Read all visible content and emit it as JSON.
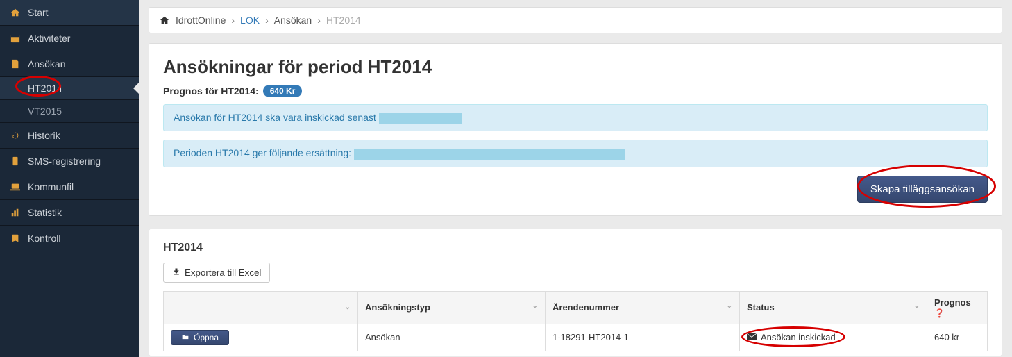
{
  "sidebar": {
    "items": [
      {
        "label": "Start"
      },
      {
        "label": "Aktiviteter"
      },
      {
        "label": "Ansökan"
      },
      {
        "label": "Historik"
      },
      {
        "label": "SMS-registrering"
      },
      {
        "label": "Kommunfil"
      },
      {
        "label": "Statistik"
      },
      {
        "label": "Kontroll"
      }
    ],
    "sub_items": [
      {
        "label": "HT2014",
        "active": true
      },
      {
        "label": "VT2015",
        "active": false
      }
    ]
  },
  "breadcrumb": {
    "home": "IdrottOnline",
    "link1": "LOK",
    "link2": "Ansökan",
    "current": "HT2014"
  },
  "panel1": {
    "title": "Ansökningar för period HT2014",
    "prognos_label": "Prognos för HT2014:",
    "prognos_badge": "640 Kr",
    "alert1": "Ansökan för HT2014 ska vara inskickad senast",
    "alert2": "Perioden HT2014 ger följande ersättning:",
    "create_button": "Skapa tilläggsansökan"
  },
  "panel2": {
    "section_title": "HT2014",
    "export_button": "Exportera till Excel",
    "columns": {
      "col1": "",
      "col2": "Ansökningstyp",
      "col3": "Ärendenummer",
      "col4": "Status",
      "col5": "Prognos"
    },
    "rows": [
      {
        "open": "Öppna",
        "type": "Ansökan",
        "case_no": "1-18291-HT2014-1",
        "status": "Ansökan inskickad",
        "prognos": "640 kr"
      }
    ]
  }
}
